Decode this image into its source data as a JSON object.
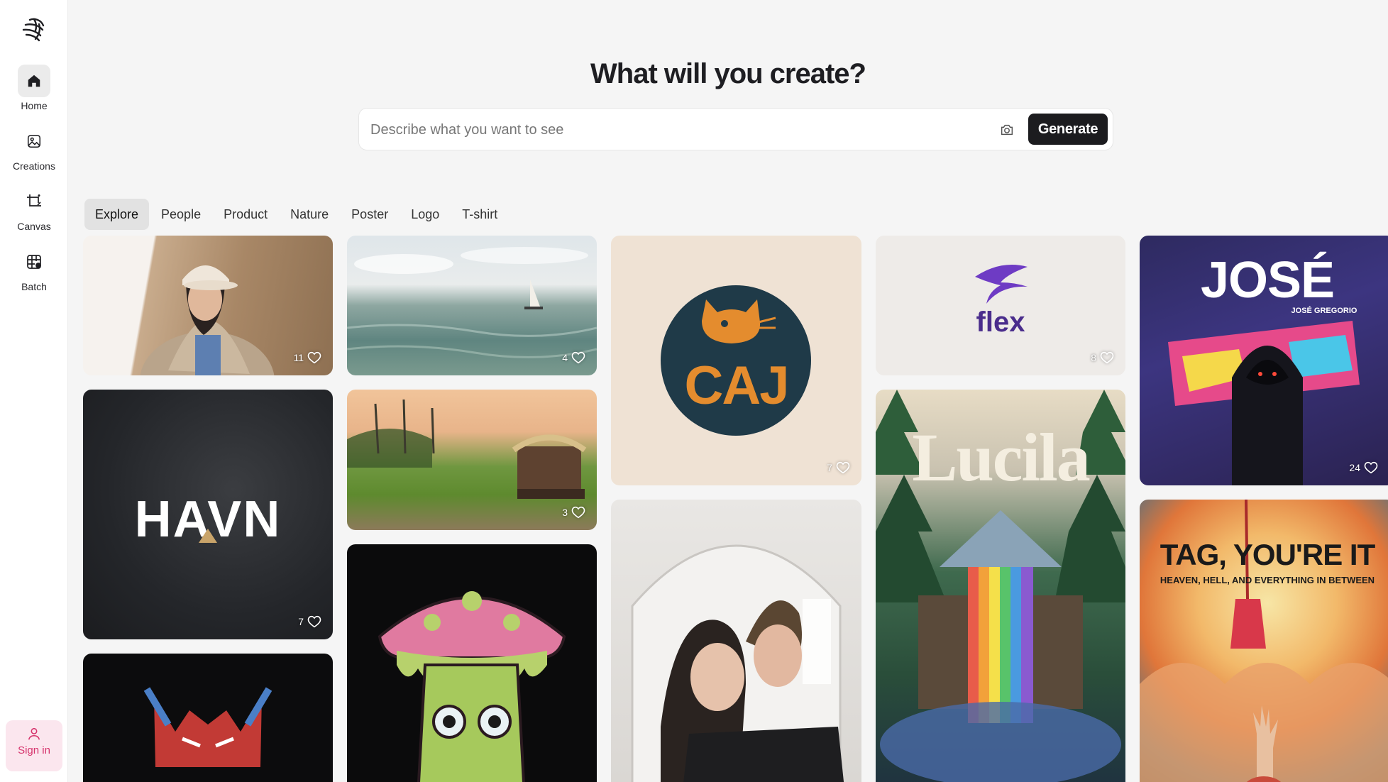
{
  "sidebar": {
    "items": [
      {
        "label": "Home",
        "icon": "home-icon"
      },
      {
        "label": "Creations",
        "icon": "image-icon"
      },
      {
        "label": "Canvas",
        "icon": "canvas-icon"
      },
      {
        "label": "Batch",
        "icon": "batch-icon"
      }
    ],
    "signin_label": "Sign in"
  },
  "header": {
    "title": "What will you create?",
    "search_placeholder": "Describe what you want to see",
    "generate_label": "Generate"
  },
  "tabs": [
    "Explore",
    "People",
    "Product",
    "Nature",
    "Poster",
    "Logo",
    "T-shirt"
  ],
  "gallery": [
    {
      "subject": "woman in cap",
      "likes": "11"
    },
    {
      "subject": "ocean sailboat",
      "likes": "4"
    },
    {
      "subject": "cat logo",
      "text": "CAJ",
      "likes": "7"
    },
    {
      "subject": "flex logo",
      "text": "flex",
      "likes": "8"
    },
    {
      "subject": "jose graffiti",
      "text": "JOSÉ",
      "subtext": "JOSÉ GREGORIO",
      "likes": "24"
    },
    {
      "subject": "havn logo",
      "text": "HAVN",
      "likes": "7"
    },
    {
      "subject": "kerala houseboat",
      "likes": "3"
    },
    {
      "subject": "lucila waterfall",
      "text": "Lucila"
    },
    {
      "subject": "couple photo"
    },
    {
      "subject": "mushroom tshirt"
    },
    {
      "subject": "tag poster",
      "text": "TAG, YOU'RE IT",
      "subtext": "HEAVEN, HELL, AND EVERYTHING IN BETWEEN"
    },
    {
      "subject": "red beast"
    }
  ],
  "colors": {
    "accent_pink": "#d6336c",
    "signin_bg": "#fbe6ee",
    "button_dark": "#1c1c1f"
  }
}
